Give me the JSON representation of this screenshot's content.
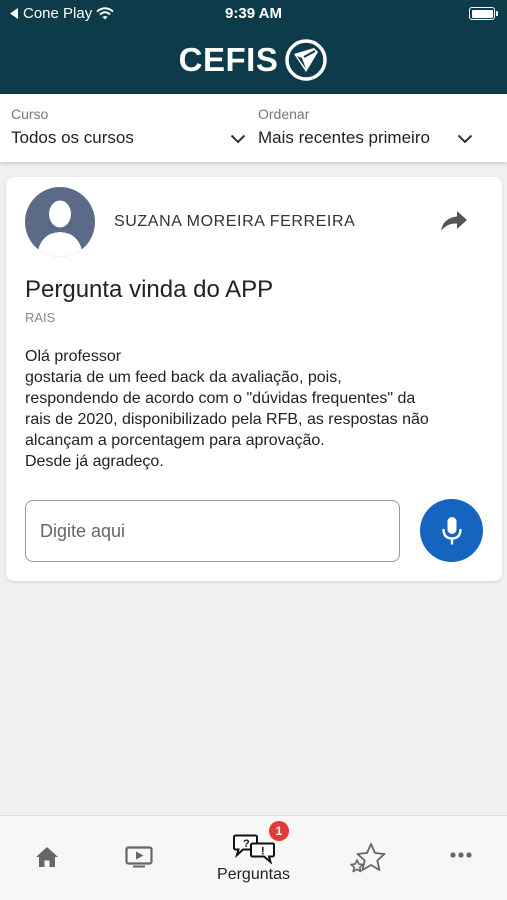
{
  "status_bar": {
    "carrier": "Cone Play",
    "time": "9:39 AM"
  },
  "brand": {
    "logo_text": "CEFIS",
    "header_color": "#0d3b4a"
  },
  "filters": {
    "course": {
      "label": "Curso",
      "value": "Todos os cursos"
    },
    "order": {
      "label": "Ordenar",
      "value": "Mais recentes primeiro"
    }
  },
  "question": {
    "author": "SUZANA MOREIRA FERREIRA",
    "title": "Pergunta vinda do APP",
    "tag": "RAIS",
    "body_lines": [
      "Olá professor",
      "gostaria de um feed back da avaliação, pois,",
      "respondendo de acordo com o \"dúvidas frequentes\" da",
      "rais de 2020, disponibilizado pela RFB, as respostas não",
      "alcançam a porcentagem para aprovação.",
      "Desde já agradeço."
    ],
    "reply_placeholder": "Digite aqui"
  },
  "tabbar": {
    "questions_label": "Perguntas",
    "questions_badge": "1",
    "accent_color": "#1565c0",
    "badge_color": "#e53935"
  }
}
